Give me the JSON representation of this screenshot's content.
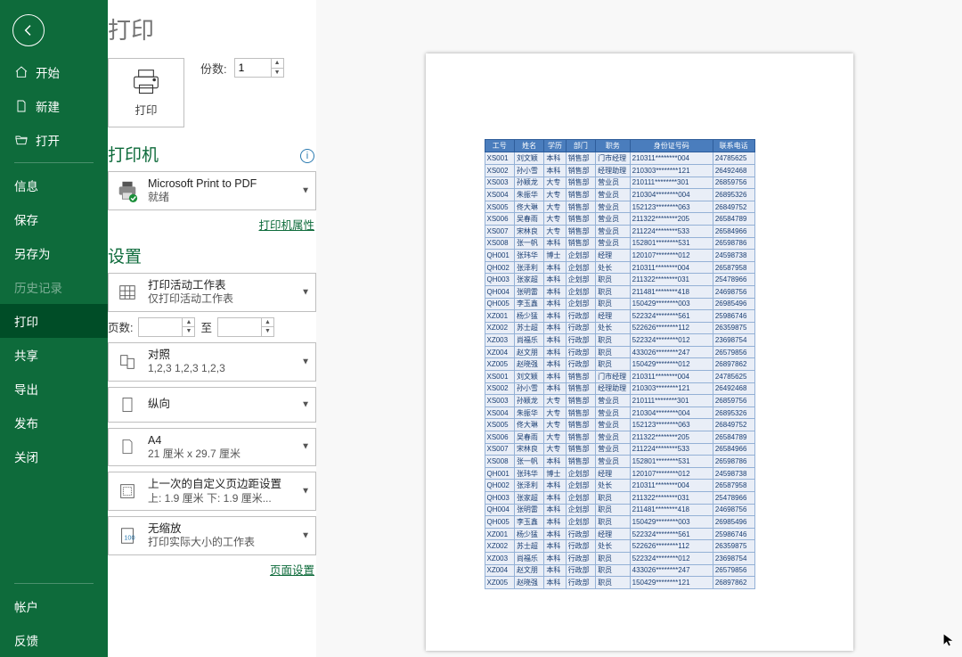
{
  "sidebar": {
    "items": [
      {
        "label": "开始",
        "icon": "home"
      },
      {
        "label": "新建",
        "icon": "new"
      },
      {
        "label": "打开",
        "icon": "open"
      }
    ],
    "items2": [
      {
        "label": "信息"
      },
      {
        "label": "保存"
      },
      {
        "label": "另存为"
      },
      {
        "label": "历史记录",
        "dim": true
      },
      {
        "label": "打印",
        "sel": true
      },
      {
        "label": "共享"
      },
      {
        "label": "导出"
      },
      {
        "label": "发布"
      },
      {
        "label": "关闭"
      }
    ],
    "footer": [
      {
        "label": "帐户"
      },
      {
        "label": "反馈"
      }
    ]
  },
  "title": "打印",
  "copies": {
    "label": "份数:",
    "value": "1"
  },
  "print_btn": "打印",
  "printer_section": "打印机",
  "printer": {
    "name": "Microsoft Print to PDF",
    "status": "就绪"
  },
  "printer_props": "打印机属性",
  "settings_section": "设置",
  "dd_sheet": {
    "l1": "打印活动工作表",
    "l2": "仅打印活动工作表"
  },
  "pages": {
    "label": "页数:",
    "to": "至"
  },
  "dd_collate": {
    "l1": "对照",
    "l2": "1,2,3    1,2,3    1,2,3"
  },
  "dd_orient": {
    "l1": "纵向"
  },
  "dd_paper": {
    "l1": "A4",
    "l2": "21 厘米 x 29.7 厘米"
  },
  "dd_margin": {
    "l1": "上一次的自定义页边距设置",
    "l2": "上: 1.9 厘米 下: 1.9 厘米..."
  },
  "dd_scale": {
    "l1": "无缩放",
    "l2": "打印实际大小的工作表"
  },
  "page_setup": "页面设置",
  "table": {
    "headers": [
      "工号",
      "姓名",
      "学历",
      "部门",
      "职务",
      "身份证号码",
      "联系电话"
    ],
    "rows": [
      [
        "XS001",
        "刘文颖",
        "本科",
        "销售部",
        "门市经理",
        "210311********004",
        "24785625"
      ],
      [
        "XS002",
        "孙小雪",
        "本科",
        "销售部",
        "经理助理",
        "210303********121",
        "26492468"
      ],
      [
        "XS003",
        "孙颖龙",
        "大专",
        "销售部",
        "营业员",
        "210111********301",
        "26859756"
      ],
      [
        "XS004",
        "朱振华",
        "大专",
        "销售部",
        "营业员",
        "210304********004",
        "26895326"
      ],
      [
        "XS005",
        "佟大琳",
        "大专",
        "销售部",
        "营业员",
        "152123********063",
        "26849752"
      ],
      [
        "XS006",
        "吴春雨",
        "大专",
        "销售部",
        "营业员",
        "211322********205",
        "26584789"
      ],
      [
        "XS007",
        "宋林良",
        "大专",
        "销售部",
        "营业员",
        "211224********533",
        "26584966"
      ],
      [
        "XS008",
        "张一帆",
        "本科",
        "销售部",
        "营业员",
        "152801********531",
        "26598786"
      ],
      [
        "QH001",
        "张玮华",
        "博士",
        "企划部",
        "经理",
        "120107********012",
        "24598738"
      ],
      [
        "QH002",
        "张泽利",
        "本科",
        "企划部",
        "处长",
        "210311********004",
        "26587958"
      ],
      [
        "QH003",
        "张家超",
        "本科",
        "企划部",
        "职员",
        "211322********031",
        "25478966"
      ],
      [
        "QH004",
        "张明雷",
        "本科",
        "企划部",
        "职员",
        "211481********418",
        "24698756"
      ],
      [
        "QH005",
        "李玉鑫",
        "本科",
        "企划部",
        "职员",
        "150429********003",
        "26985496"
      ],
      [
        "XZ001",
        "杨少猛",
        "本科",
        "行政部",
        "经理",
        "522324********561",
        "25986746"
      ],
      [
        "XZ002",
        "苏士超",
        "本科",
        "行政部",
        "处长",
        "522626********112",
        "26359875"
      ],
      [
        "XZ003",
        "尚福乐",
        "本科",
        "行政部",
        "职员",
        "522324********012",
        "23698754"
      ],
      [
        "XZ004",
        "赵文朋",
        "本科",
        "行政部",
        "职员",
        "433026********247",
        "26579856"
      ],
      [
        "XZ005",
        "赵晓强",
        "本科",
        "行政部",
        "职员",
        "150429********012",
        "26897862"
      ],
      [
        "XS001",
        "刘文颖",
        "本科",
        "销售部",
        "门市经理",
        "210311********004",
        "24785625"
      ],
      [
        "XS002",
        "孙小雪",
        "本科",
        "销售部",
        "经理助理",
        "210303********121",
        "26492468"
      ],
      [
        "XS003",
        "孙颖龙",
        "大专",
        "销售部",
        "营业员",
        "210111********301",
        "26859756"
      ],
      [
        "XS004",
        "朱振华",
        "大专",
        "销售部",
        "营业员",
        "210304********004",
        "26895326"
      ],
      [
        "XS005",
        "佟大琳",
        "大专",
        "销售部",
        "营业员",
        "152123********063",
        "26849752"
      ],
      [
        "XS006",
        "吴春雨",
        "大专",
        "销售部",
        "营业员",
        "211322********205",
        "26584789"
      ],
      [
        "XS007",
        "宋林良",
        "大专",
        "销售部",
        "营业员",
        "211224********533",
        "26584966"
      ],
      [
        "XS008",
        "张一帆",
        "本科",
        "销售部",
        "营业员",
        "152801********531",
        "26598786"
      ],
      [
        "QH001",
        "张玮华",
        "博士",
        "企划部",
        "经理",
        "120107********012",
        "24598738"
      ],
      [
        "QH002",
        "张泽利",
        "本科",
        "企划部",
        "处长",
        "210311********004",
        "26587958"
      ],
      [
        "QH003",
        "张家超",
        "本科",
        "企划部",
        "职员",
        "211322********031",
        "25478966"
      ],
      [
        "QH004",
        "张明雷",
        "本科",
        "企划部",
        "职员",
        "211481********418",
        "24698756"
      ],
      [
        "QH005",
        "李玉鑫",
        "本科",
        "企划部",
        "职员",
        "150429********003",
        "26985496"
      ],
      [
        "XZ001",
        "杨少猛",
        "本科",
        "行政部",
        "经理",
        "522324********561",
        "25986746"
      ],
      [
        "XZ002",
        "苏士超",
        "本科",
        "行政部",
        "处长",
        "522626********112",
        "26359875"
      ],
      [
        "XZ003",
        "尚福乐",
        "本科",
        "行政部",
        "职员",
        "522324********012",
        "23698754"
      ],
      [
        "XZ004",
        "赵文朋",
        "本科",
        "行政部",
        "职员",
        "433026********247",
        "26579856"
      ],
      [
        "XZ005",
        "赵晓强",
        "本科",
        "行政部",
        "职员",
        "150429********121",
        "26897862"
      ]
    ]
  }
}
